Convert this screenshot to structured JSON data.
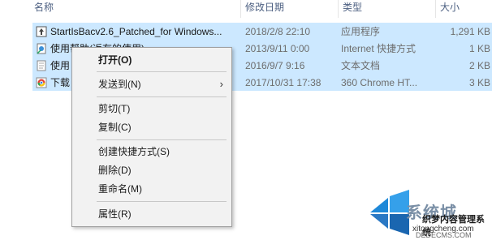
{
  "columns": {
    "name": "名称",
    "date": "修改日期",
    "type": "类型",
    "size": "大小"
  },
  "files": [
    {
      "name": "StartIsBacv2.6_Patched_for Windows...",
      "date": "2018/2/8 22:10",
      "type": "应用程序",
      "size": "1,291 KB",
      "icon": "app-icon"
    },
    {
      "name": "使用帮助(返有的使用)",
      "date": "2013/9/11 0:00",
      "type": "Internet 快捷方式",
      "size": "1 KB",
      "icon": "internet-shortcut-icon"
    },
    {
      "name": "使用",
      "date": "2016/9/7 9:16",
      "type": "文本文档",
      "size": "2 KB",
      "icon": "text-document-icon"
    },
    {
      "name": "下载",
      "date": "2017/10/31 17:38",
      "type": "360 Chrome HT...",
      "size": "3 KB",
      "icon": "chrome-html-icon"
    }
  ],
  "context_menu": {
    "open": "打开(O)",
    "send_to": "发送到(N)",
    "cut": "剪切(T)",
    "copy": "复制(C)",
    "create_shortcut": "创建快捷方式(S)",
    "delete": "删除(D)",
    "rename": "重命名(M)",
    "properties": "属性(R)",
    "submenu_arrow": "›"
  },
  "watermark": {
    "title": "系统城",
    "subtitle": "织梦内容管理系统",
    "site": "xitongcheng.com",
    "site2": "DEDECMS.COM"
  },
  "colors": {
    "selection": "#cce8ff",
    "menu_bg": "#f2f2f2",
    "header_text": "#4d6082"
  }
}
